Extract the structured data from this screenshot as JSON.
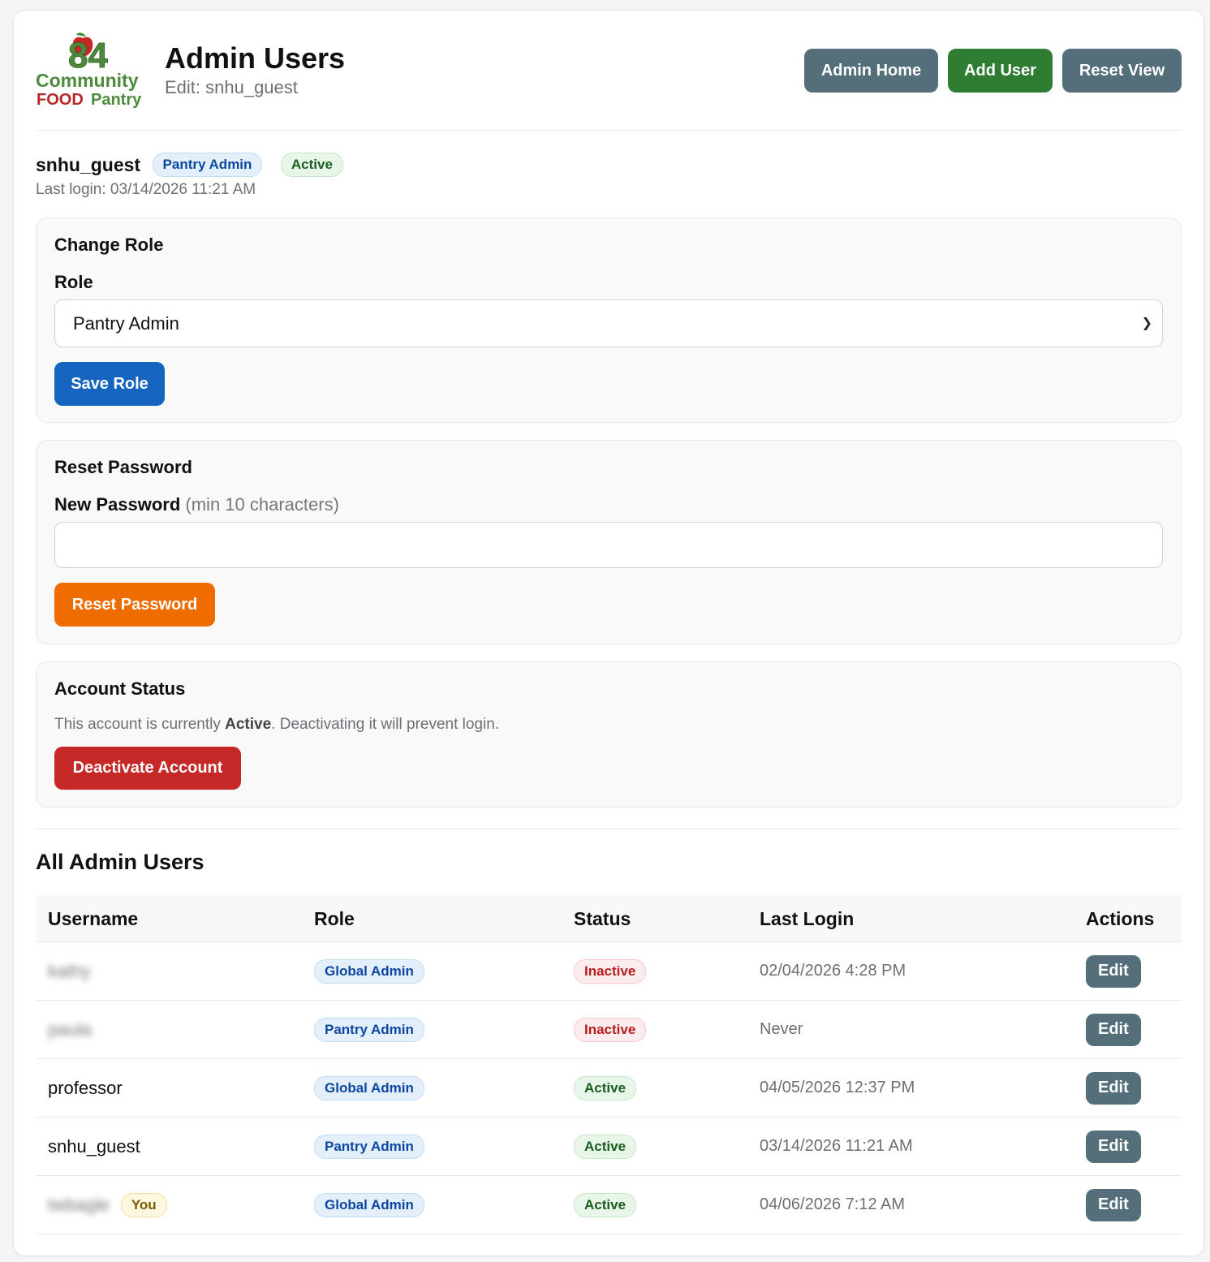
{
  "logo": {
    "number": "84",
    "line1": "Community",
    "line2a": "FOOD",
    "line2b": "Pantry"
  },
  "header": {
    "title": "Admin Users",
    "subtitle": "Edit: snhu_guest",
    "buttons": {
      "admin_home": "Admin Home",
      "add_user": "Add User",
      "reset_view": "Reset View"
    }
  },
  "user": {
    "username": "snhu_guest",
    "role_badge": "Pantry Admin",
    "status_badge": "Active",
    "last_login": "Last login: 03/14/2026 11:21 AM"
  },
  "change_role": {
    "heading": "Change Role",
    "label": "Role",
    "selected": "Pantry Admin",
    "button": "Save Role"
  },
  "reset_password": {
    "heading": "Reset Password",
    "label": "New Password",
    "hint": "(min 10 characters)",
    "value": "",
    "button": "Reset Password"
  },
  "account_status": {
    "heading": "Account Status",
    "text_before": "This account is currently ",
    "status": "Active",
    "text_after": ". Deactivating it will prevent login.",
    "button": "Deactivate Account"
  },
  "all_users": {
    "heading": "All Admin Users",
    "columns": [
      "Username",
      "Role",
      "Status",
      "Last Login",
      "Actions"
    ],
    "rows": [
      {
        "username": "kathy",
        "role": "Global Admin",
        "status": "Inactive",
        "last_login": "02/04/2026 4:28 PM",
        "action": "Edit"
      },
      {
        "username": "paula",
        "role": "Pantry Admin",
        "status": "Inactive",
        "last_login": "Never",
        "action": "Edit"
      },
      {
        "username": "professor",
        "role": "Global Admin",
        "status": "Active",
        "last_login": "04/05/2026 12:37 PM",
        "action": "Edit"
      },
      {
        "username": "snhu_guest",
        "role": "Pantry Admin",
        "status": "Active",
        "last_login": "03/14/2026 11:21 AM",
        "action": "Edit"
      },
      {
        "username": "twbagle",
        "you_badge": "You",
        "role": "Global Admin",
        "status": "Active",
        "last_login": "04/06/2026 7:12 AM",
        "action": "Edit"
      }
    ]
  },
  "colors": {
    "slate": "#546e7a",
    "green": "#2e7d32",
    "blue": "#1565c0",
    "orange": "#ef6c00",
    "red": "#c62828",
    "logo_green": "#4d8a3c",
    "logo_red": "#b8282a"
  }
}
